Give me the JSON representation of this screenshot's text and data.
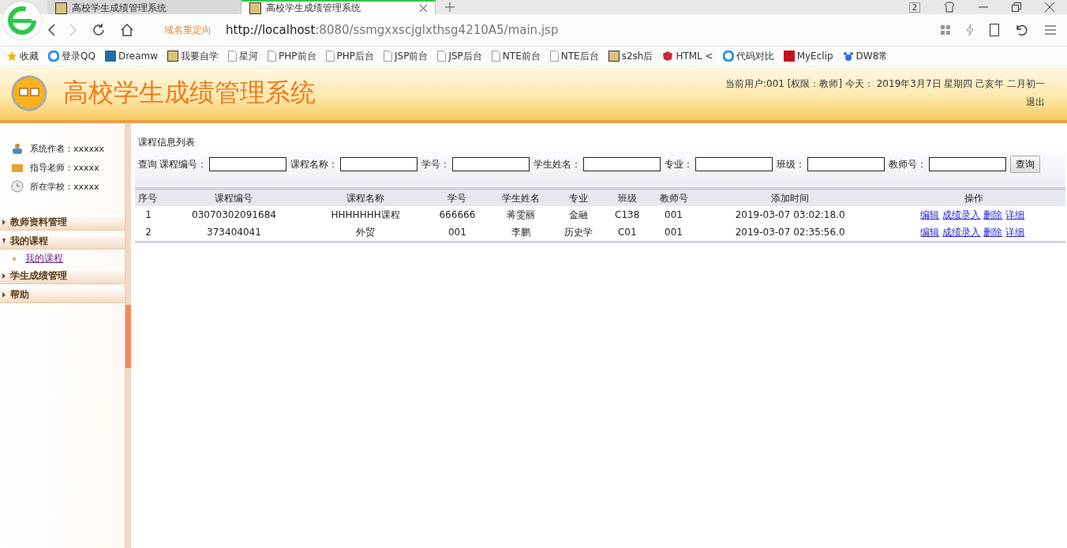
{
  "browser": {
    "tabs": [
      {
        "title": "高校学生成绩管理系统",
        "selected": false
      },
      {
        "title": "高校学生成绩管理系统",
        "selected": true
      }
    ],
    "window_count": "2",
    "redirect_label": "域名重定向",
    "url": {
      "host": "http://localhost",
      "path": ":8080/ssmgxxscjglxthsg4210A5/main.jsp"
    },
    "bookmarks": [
      {
        "label": "收藏",
        "kind": "star"
      },
      {
        "label": "登录QQ",
        "kind": "circle"
      },
      {
        "label": "Dreamw",
        "kind": "dw"
      },
      {
        "label": "我要自学",
        "kind": "image"
      },
      {
        "label": "星河",
        "kind": "page"
      },
      {
        "label": "PHP前台",
        "kind": "page"
      },
      {
        "label": "PHP后台",
        "kind": "page"
      },
      {
        "label": "JSP前台",
        "kind": "page"
      },
      {
        "label": "JSP后台",
        "kind": "page"
      },
      {
        "label": "NTE前台",
        "kind": "page"
      },
      {
        "label": "NTE后台",
        "kind": "page"
      },
      {
        "label": "s2sh后",
        "kind": "image"
      },
      {
        "label": "HTML <",
        "kind": "h5"
      },
      {
        "label": "代码对比",
        "kind": "circle"
      },
      {
        "label": "MyEclip",
        "kind": "red"
      },
      {
        "label": "DW8常",
        "kind": "paw"
      }
    ]
  },
  "header": {
    "title": "高校学生成绩管理系统",
    "user_info": "当前用户:001 [权限：教师] 今天： 2019年3月7日 星期四 己亥年 二月初一",
    "logout": "退出"
  },
  "sidebar": {
    "info": [
      {
        "label": "系统作者：xxxxxx",
        "kind": "people"
      },
      {
        "label": "指导老师：xxxxx",
        "kind": "box"
      },
      {
        "label": "所在学校：xxxxx",
        "kind": "clock"
      }
    ],
    "sections": [
      {
        "label": "教师资料管理",
        "expanded": false
      },
      {
        "label": "我的课程",
        "expanded": true,
        "children": [
          {
            "label": "我的课程"
          }
        ]
      },
      {
        "label": "学生成绩管理",
        "expanded": false
      },
      {
        "label": "帮助",
        "expanded": false
      }
    ]
  },
  "panel": {
    "title": "课程信息列表",
    "search_label": "查询",
    "filters": [
      {
        "label": "课程编号："
      },
      {
        "label": "课程名称："
      },
      {
        "label": "学号："
      },
      {
        "label": "学生姓名："
      },
      {
        "label": "专业："
      },
      {
        "label": "班级："
      },
      {
        "label": "教师号："
      }
    ],
    "search_button": "查询",
    "table": {
      "columns": [
        "序号",
        "课程编号",
        "课程名称",
        "学号",
        "学生姓名",
        "专业",
        "班级",
        "教师号",
        "添加时间",
        "操作"
      ],
      "rows": [
        {
          "cells": [
            "1",
            "03070302091684",
            "HHHHHHH课程",
            "666666",
            "蒋雯丽",
            "金融",
            "C138",
            "001",
            "2019-03-07 03:02:18.0"
          ],
          "actions": [
            "编辑",
            "成绩录入",
            "删除",
            "详细"
          ]
        },
        {
          "cells": [
            "2",
            "373404041",
            "外贸",
            "001",
            "李鹏",
            "历史学",
            "C01",
            "001",
            "2019-03-07 02:35:56.0"
          ],
          "actions": [
            "编辑",
            "成绩录入",
            "删除",
            "详细"
          ]
        }
      ]
    }
  }
}
